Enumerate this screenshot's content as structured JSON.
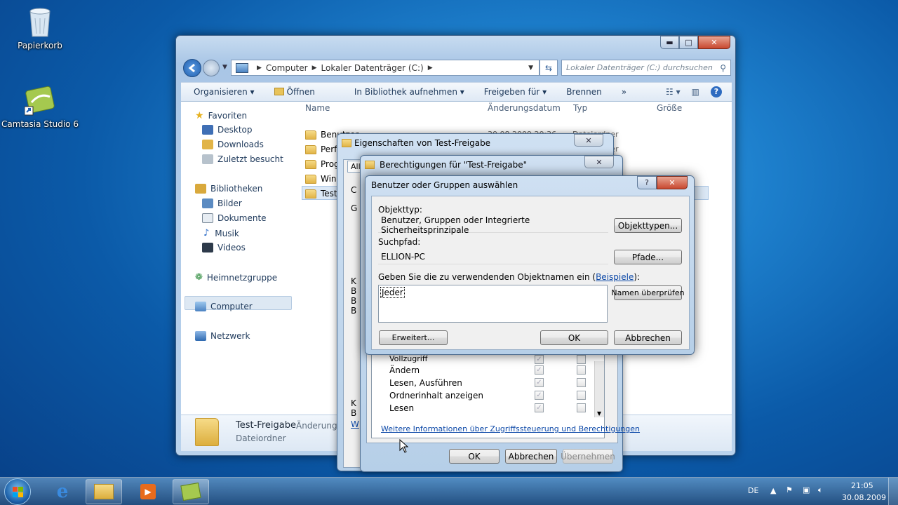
{
  "desktop": {
    "icons": [
      {
        "label": "Papierkorb",
        "icon": "recycle-bin-icon"
      },
      {
        "label": "Camtasia Studio 6",
        "icon": "camtasia-icon"
      }
    ]
  },
  "explorer": {
    "breadcrumb": [
      "Computer",
      "Lokaler Datenträger (C:)"
    ],
    "search_placeholder": "Lokaler Datenträger (C:) durchsuchen",
    "toolbar": [
      "Organisieren ▾",
      "Öffnen",
      "In Bibliothek aufnehmen ▾",
      "Freigeben für ▾",
      "Brennen",
      "»"
    ],
    "nav": {
      "favorites": "Favoriten",
      "favorites_items": [
        "Desktop",
        "Downloads",
        "Zuletzt besucht"
      ],
      "libraries": "Bibliotheken",
      "libraries_items": [
        "Bilder",
        "Dokumente",
        "Musik",
        "Videos"
      ],
      "homegroup": "Heimnetzgruppe",
      "computer": "Computer",
      "network": "Netzwerk"
    },
    "columns": [
      "Name",
      "Änderungsdatum",
      "Typ",
      "Größe"
    ],
    "files": [
      {
        "name": "Benutzer",
        "date": "30.08.2009 20:36",
        "type": "Dateiordner"
      },
      {
        "name": "Perf",
        "date": "",
        "type": "Dateiordner"
      },
      {
        "name": "Prog",
        "date": "",
        "type": ""
      },
      {
        "name": "Wind",
        "date": "",
        "type": ""
      },
      {
        "name": "Test",
        "date": "",
        "type": ""
      }
    ],
    "details": {
      "name": "Test-Freigabe",
      "meta": "Änderungs",
      "type": "Dateiordner"
    }
  },
  "dialog_properties": {
    "title": "Eigenschaften von Test-Freigabe",
    "tab": "All",
    "frag_c": "C",
    "frag_g": "G",
    "frag_k": "K",
    "frag_b": "B",
    "frag_w": "W"
  },
  "dialog_permissions": {
    "title": "Berechtigungen für \"Test-Freigabe\"",
    "permissions": [
      {
        "label": "Vollzugriff",
        "allow": true,
        "deny": false
      },
      {
        "label": "Ändern",
        "allow": true,
        "deny": false
      },
      {
        "label": "Lesen, Ausführen",
        "allow": true,
        "deny": false
      },
      {
        "label": "Ordnerinhalt anzeigen",
        "allow": true,
        "deny": false
      },
      {
        "label": "Lesen",
        "allow": true,
        "deny": false
      }
    ],
    "info_link": "Weitere Informationen über Zugriffssteuerung und Berechtigungen",
    "ok": "OK",
    "cancel": "Abbrechen",
    "apply": "Übernehmen"
  },
  "dialog_select": {
    "title": "Benutzer oder Gruppen auswählen",
    "object_type_label": "Objekttyp:",
    "object_type_value": "Benutzer, Gruppen oder Integrierte Sicherheitsprinzipale",
    "object_types_button": "Objekttypen...",
    "search_path_label": "Suchpfad:",
    "search_path_value": "ELLION-PC",
    "paths_button": "Pfade...",
    "names_label": "Geben Sie die zu verwendenden Objektnamen ein (",
    "examples_link": "Beispiele",
    "names_label_end": "):",
    "names_value": "Jeder",
    "check_names_button": "Namen überprüfen",
    "advanced_button": "Erweitert...",
    "ok": "OK",
    "cancel": "Abbrechen",
    "help_glyph": "?"
  },
  "taskbar": {
    "language": "DE",
    "time": "21:05",
    "date": "30.08.2009"
  }
}
